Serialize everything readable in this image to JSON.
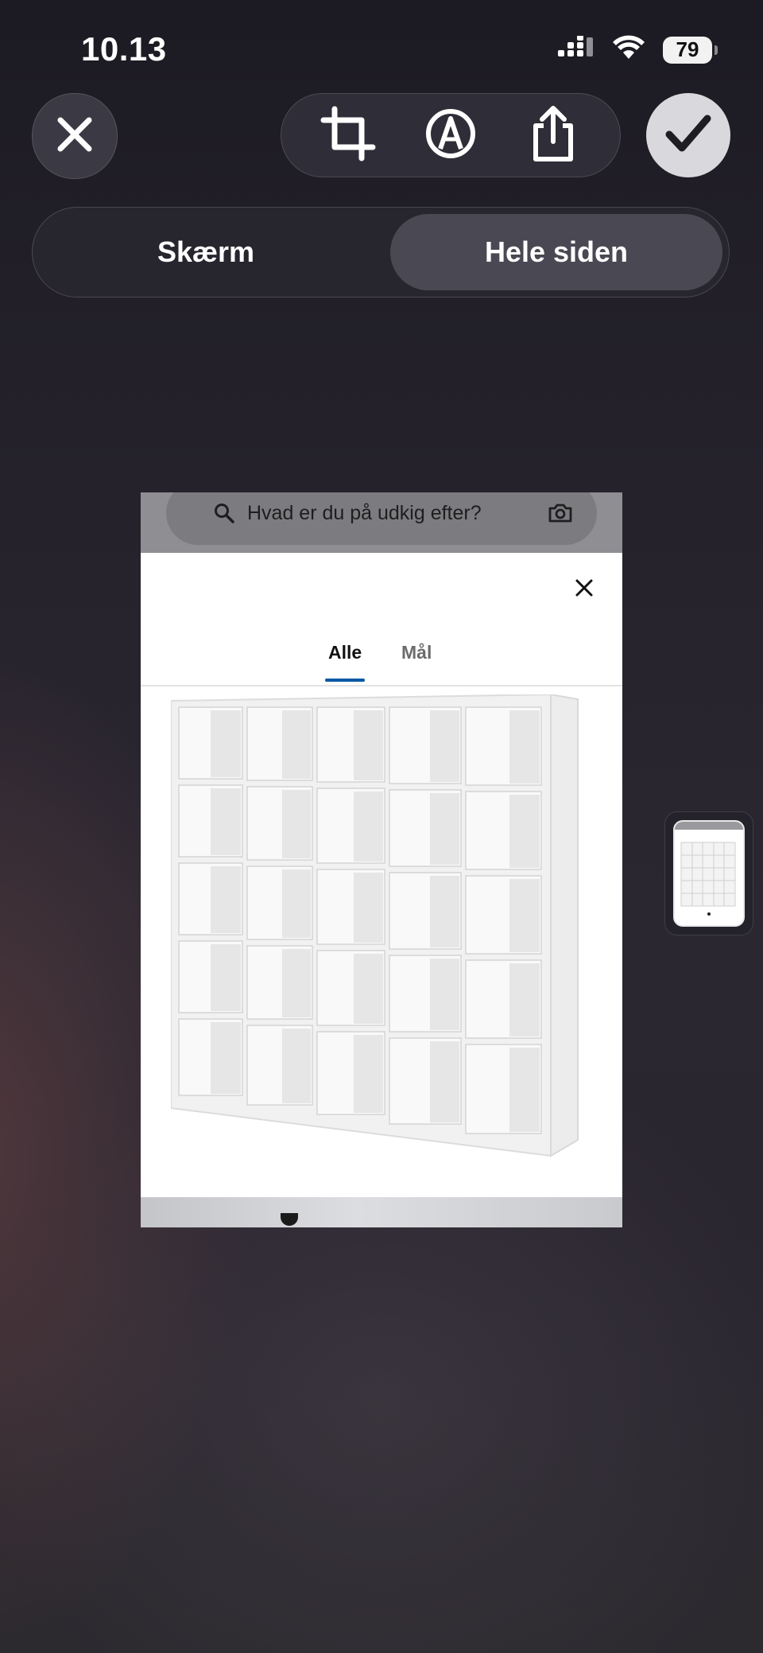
{
  "status_bar": {
    "time": "10.13",
    "battery_level": "79",
    "icons": [
      "cellular-signal-icon",
      "wifi-icon",
      "battery-icon"
    ]
  },
  "toolbar": {
    "close_icon": "close-icon",
    "tools": [
      "crop-icon",
      "markup-icon",
      "share-icon"
    ],
    "done_icon": "checkmark-icon"
  },
  "capture_mode": {
    "options": [
      "Skærm",
      "Hele siden"
    ],
    "selected": "Hele siden"
  },
  "preview": {
    "search_placeholder": "Hvad er du på udkig efter?",
    "tabs": [
      "Alle",
      "Mål"
    ],
    "active_tab": "Alle"
  },
  "colors": {
    "accent_underline": "#0058a3",
    "selected_segment": "#4a4852",
    "done_button": "#d9d8dc"
  }
}
